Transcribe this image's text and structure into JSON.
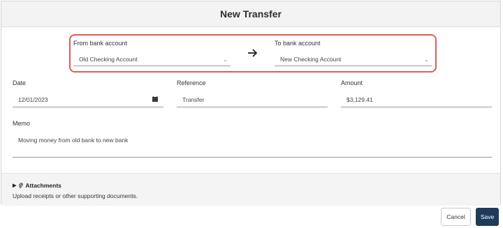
{
  "dialog": {
    "title": "New Transfer"
  },
  "from_account": {
    "label": "From bank account",
    "value": "Old Checking Account"
  },
  "to_account": {
    "label": "To bank account",
    "value": "New Checking Account"
  },
  "date": {
    "label": "Date",
    "value": "12/01/2023"
  },
  "reference": {
    "label": "Reference",
    "value": "Transfer"
  },
  "amount": {
    "label": "Amount",
    "value": "$3,129.41"
  },
  "memo": {
    "label": "Memo",
    "value": "Moving money from old bank to new bank"
  },
  "attachments": {
    "title": "Attachments",
    "description": "Upload receipts or other supporting documents."
  },
  "buttons": {
    "cancel": "Cancel",
    "save": "Save"
  },
  "colors": {
    "highlight": "#d9604f",
    "save_button": "#1f3b5c",
    "header_bg": "#f3f3f3"
  },
  "icons": {
    "arrow": "arrow-right-icon",
    "calendar": "calendar-icon",
    "dropdown": "chevron-down-icon",
    "expand": "caret-right-icon",
    "attachment": "paperclip-icon"
  }
}
